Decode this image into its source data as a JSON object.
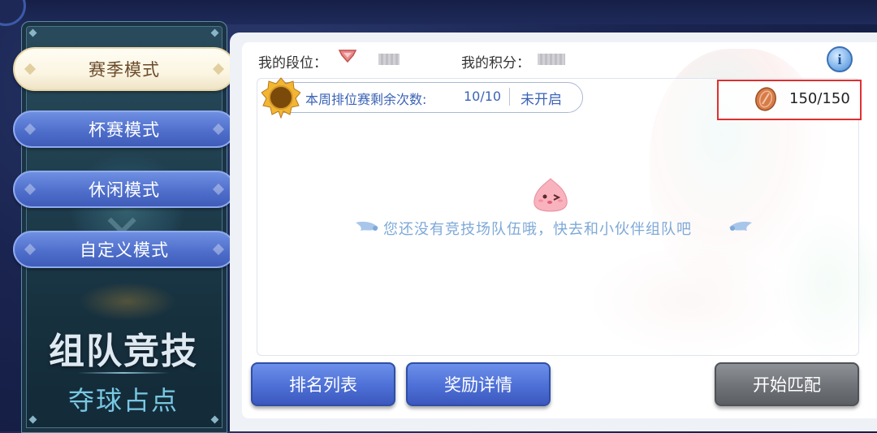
{
  "sidebar": {
    "modes": [
      {
        "label": "赛季模式",
        "active": true
      },
      {
        "label": "杯赛模式",
        "active": false
      },
      {
        "label": "休闲模式",
        "active": false
      },
      {
        "label": "自定义模式",
        "active": false
      }
    ],
    "title": "组队竞技",
    "subtitle": "夺球占点"
  },
  "header": {
    "rank_label": "我的段位：",
    "score_label": "我的积分：",
    "info_icon_text": "i"
  },
  "weekly": {
    "label": "本周排位赛剩余次数:",
    "value": "10/10",
    "status": "未开启"
  },
  "currency": {
    "value": "150/150",
    "icon": "coin-icon"
  },
  "empty_state": {
    "message": "您还没有竞技场队伍哦，快去和小伙伴组队吧"
  },
  "buttons": {
    "ranking": "排名列表",
    "rewards": "奖励详情",
    "start": "开始匹配"
  },
  "colors": {
    "accent_blue": "#4f6fcc",
    "highlight_red": "#e02f2f",
    "panel_teal": "#1f3e4d"
  }
}
